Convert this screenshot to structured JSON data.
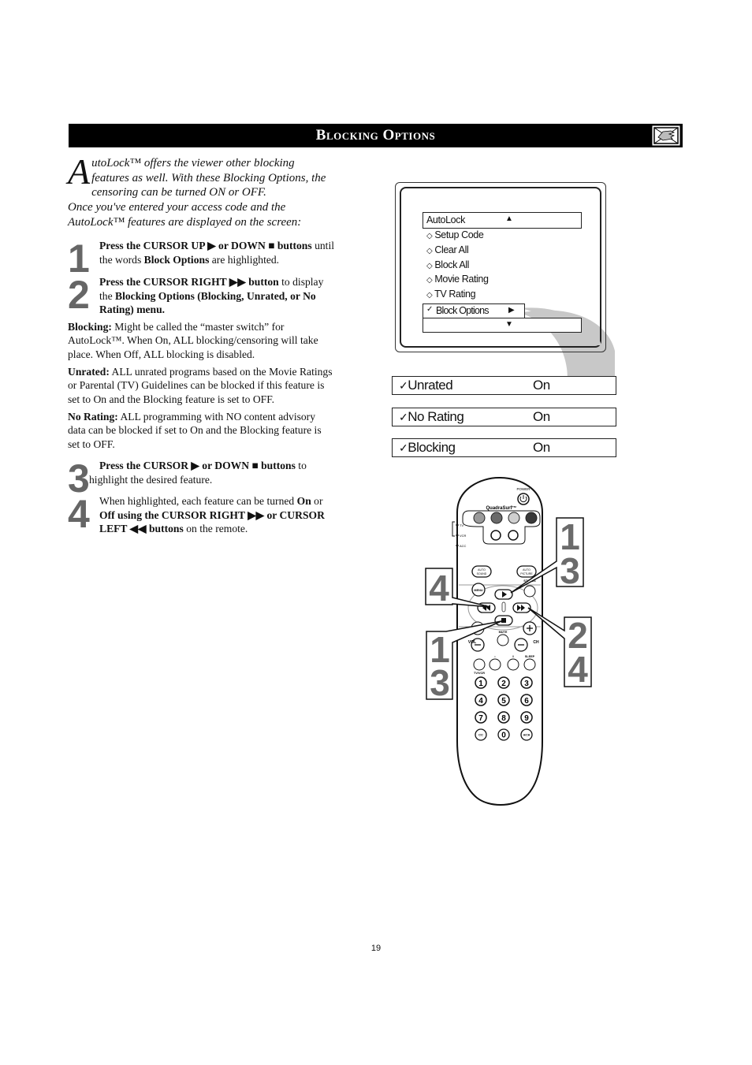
{
  "header": {
    "title": "Blocking Options",
    "icon": "hand-pointing-icon"
  },
  "intro": {
    "drop_cap": "A",
    "line1": "utoLock™ offers the viewer other blocking features as well. With these Blocking Options, the censoring can be turned ON or OFF.",
    "line2": "Once you've entered your access code and the AutoLock™ features are displayed on the screen:"
  },
  "steps": [
    {
      "number": "1",
      "parts": [
        {
          "bold": true,
          "text": "Press the CURSOR UP ▶ or DOWN ■ buttons"
        },
        {
          "bold": false,
          "text": " until the words "
        },
        {
          "bold": true,
          "text": "Block Options"
        },
        {
          "bold": false,
          "text": " are highlighted."
        }
      ]
    },
    {
      "number": "2",
      "parts": [
        {
          "bold": true,
          "text": "Press the CURSOR RIGHT ▶▶ button"
        },
        {
          "bold": false,
          "text": " to display the "
        },
        {
          "bold": true,
          "text": "Blocking Options (Blocking, Unrated, or No Rating) menu."
        }
      ]
    },
    {
      "number": "3",
      "parts": [
        {
          "bold": true,
          "text": "Press the CURSOR ▶ or DOWN ■ buttons"
        },
        {
          "bold": false,
          "text": " to highlight the desired feature."
        }
      ]
    },
    {
      "number": "4",
      "parts": [
        {
          "bold": false,
          "text": "When highlighted, each feature can be turned "
        },
        {
          "bold": true,
          "text": "On"
        },
        {
          "bold": false,
          "text": " or "
        },
        {
          "bold": true,
          "text": "Off using the CURSOR RIGHT ▶▶ or CURSOR LEFT ◀◀ buttons"
        },
        {
          "bold": false,
          "text": " on the remote."
        }
      ]
    }
  ],
  "definitions": [
    {
      "term": "Blocking:",
      "text": " Might be called the “master switch” for AutoLock™. When On, ALL blocking/censoring will take place. When Off, ALL blocking is disabled."
    },
    {
      "term": "Unrated:",
      "text": " ALL unrated programs based on the Movie Ratings or Parental (TV) Guidelines can be blocked if this feature is set to On and the Blocking feature is set to OFF."
    },
    {
      "term": "No Rating:",
      "text": " ALL programming with NO content advisory data can be blocked if set to On and the Blocking feature is set to OFF."
    }
  ],
  "tv_menu": {
    "title": "AutoLock",
    "items": [
      {
        "icon": "◇",
        "label": "Setup Code"
      },
      {
        "icon": "◇",
        "label": "Clear All"
      },
      {
        "icon": "◇",
        "label": "Block All"
      },
      {
        "icon": "◇",
        "label": "Movie Rating"
      },
      {
        "icon": "◇",
        "label": "TV Rating"
      }
    ],
    "selected": {
      "icon": "✓",
      "label": "Block Options"
    },
    "up_arrow": "▲",
    "right_arrow": "▶",
    "down_arrow": "▼"
  },
  "block_options": [
    {
      "check": "✓",
      "label": "Unrated",
      "value": "On"
    },
    {
      "check": "✓",
      "label": "No Rating",
      "value": "On"
    },
    {
      "check": "✓",
      "label": "Blocking",
      "value": "On"
    }
  ],
  "remote": {
    "power_label": "POWER",
    "brand_label": "QuadraSurf™",
    "mode_labels": [
      "TV",
      "VCR",
      "ACC"
    ],
    "auto_sound": "AUTO SOUND",
    "auto_picture": "AUTO PICTURE",
    "status": "STATUS",
    "menu": "MENU",
    "mute": "MUTE",
    "vol": "VOL",
    "ch": "CH",
    "sleep": "SLEEP",
    "tvvcr": "TV/VCR",
    "digits": [
      "1",
      "2",
      "3",
      "4",
      "5",
      "6",
      "7",
      "8",
      "9",
      "0"
    ],
    "cc": "CC",
    "ach": "A/CH",
    "callouts": {
      "top_right": [
        "1",
        "3"
      ],
      "left": [
        "4"
      ],
      "bottom_left": [
        "1",
        "3"
      ],
      "right": [
        "2",
        "4"
      ]
    }
  },
  "page_number": "19"
}
